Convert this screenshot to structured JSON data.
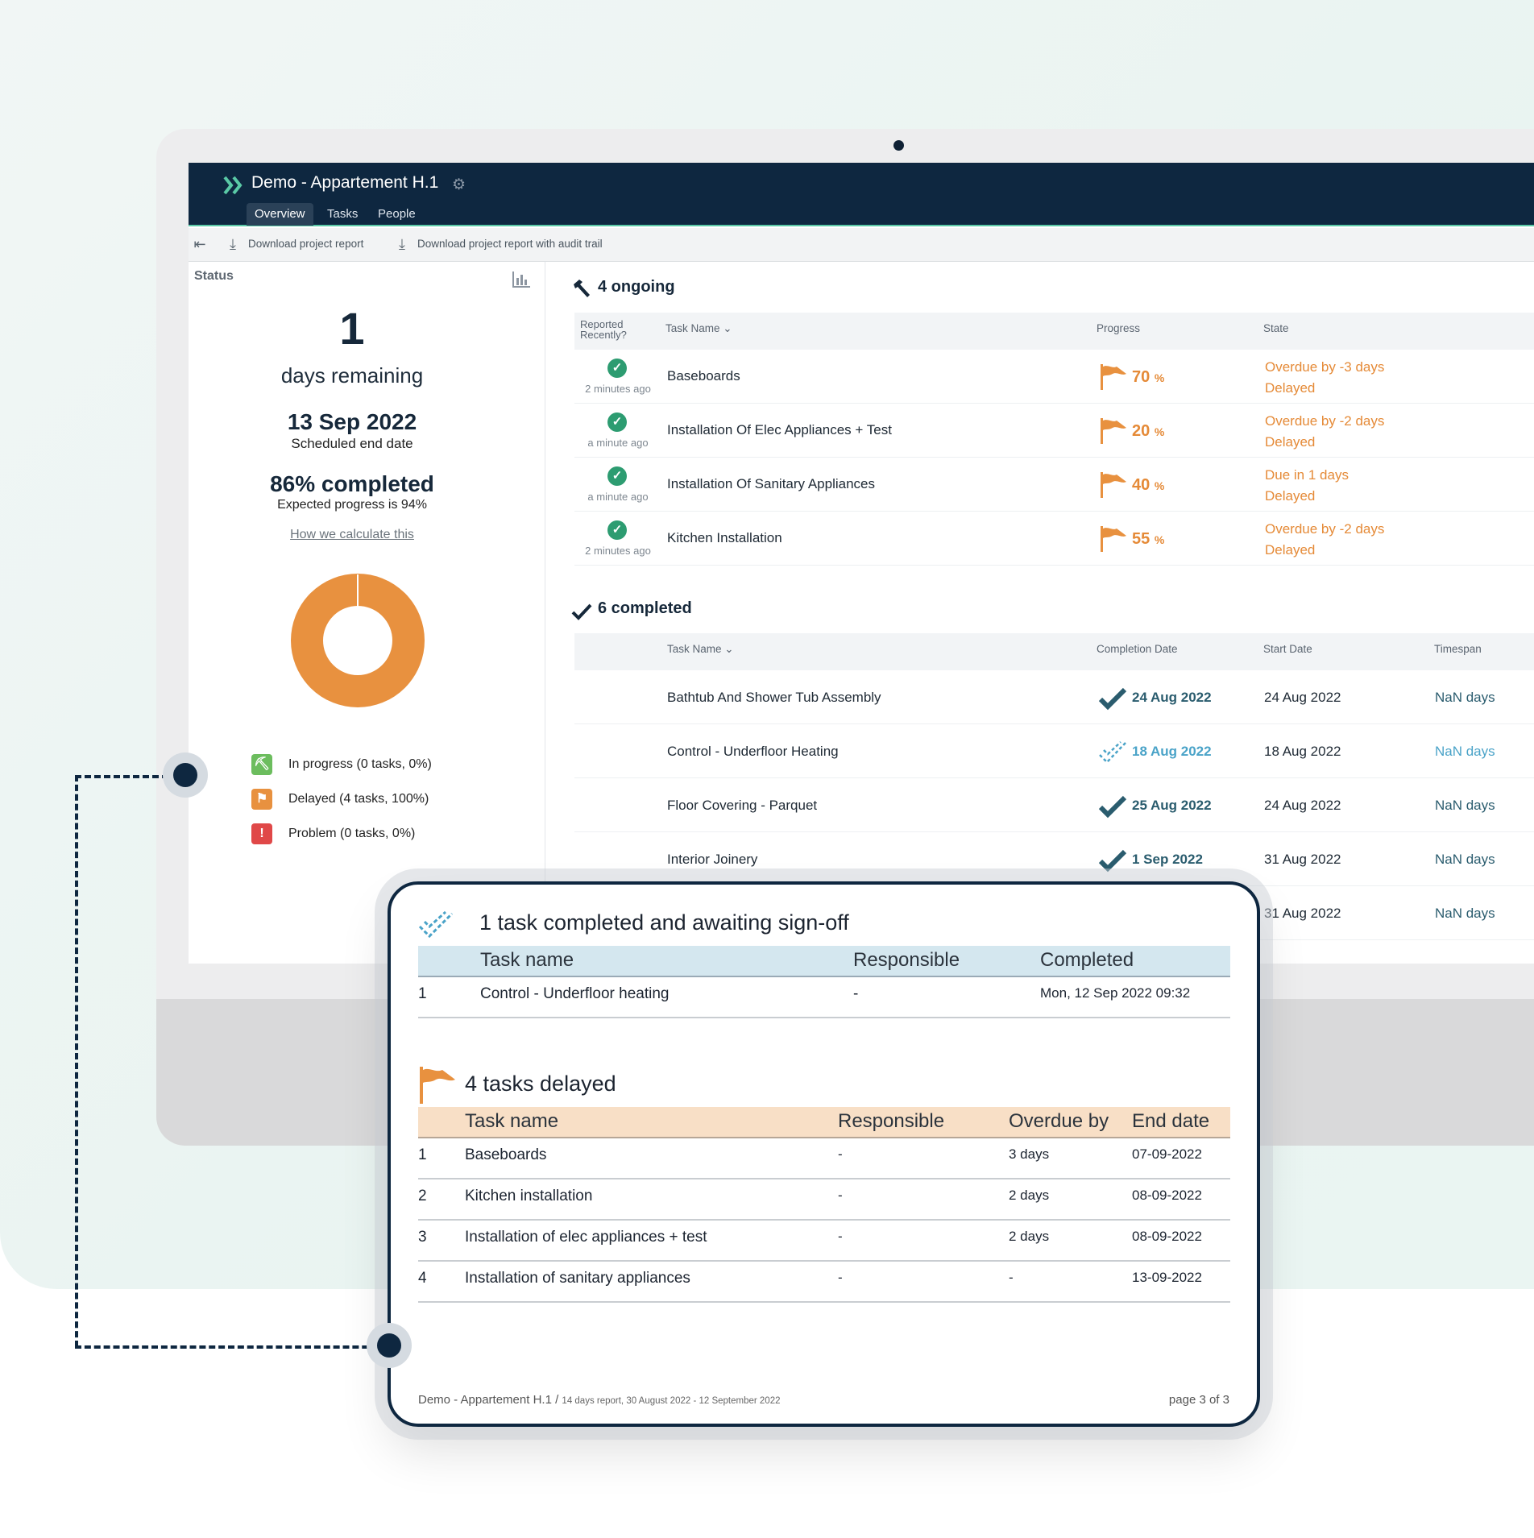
{
  "app": {
    "project_title": "Demo - Appartement H.1",
    "tabs": [
      "Overview",
      "Tasks",
      "People"
    ],
    "active_tab": "Overview"
  },
  "toolbar": {
    "download_report": "Download project report",
    "download_audit": "Download project report with audit trail"
  },
  "status": {
    "label": "Status",
    "days_remaining_value": "1",
    "days_remaining_label": "days remaining",
    "end_date": "13 Sep 2022",
    "end_date_label": "Scheduled end date",
    "completed": "86% completed",
    "expected": "Expected progress is 94%",
    "how_link": "How we calculate this",
    "donut_delayed_fraction": 1.0,
    "legend": [
      {
        "label": "In progress (0 tasks, 0%)",
        "color": "#6cbd5e",
        "icon": "worker-icon"
      },
      {
        "label": "Delayed (4 tasks, 100%)",
        "color": "#e8913f",
        "icon": "flag-icon"
      },
      {
        "label": "Problem (0 tasks, 0%)",
        "color": "#e04848",
        "icon": "exclamation-icon"
      }
    ]
  },
  "ongoing": {
    "heading": "4 ongoing",
    "columns": {
      "reported": "Reported Recently?",
      "task": "Task Name",
      "progress": "Progress",
      "state": "State"
    },
    "rows": [
      {
        "ago": "2 minutes ago",
        "task": "Baseboards",
        "progress": "70",
        "state1": "Overdue by -3 days",
        "state2": "Delayed"
      },
      {
        "ago": "a minute ago",
        "task": "Installation Of Elec Appliances + Test",
        "progress": "20",
        "state1": "Overdue by -2 days",
        "state2": "Delayed"
      },
      {
        "ago": "a minute ago",
        "task": "Installation Of Sanitary Appliances",
        "progress": "40",
        "state1": "Due in 1 days",
        "state2": "Delayed"
      },
      {
        "ago": "2 minutes ago",
        "task": "Kitchen Installation",
        "progress": "55",
        "state1": "Overdue by -2 days",
        "state2": "Delayed"
      }
    ]
  },
  "completed": {
    "heading": "6 completed",
    "columns": {
      "task": "Task Name",
      "completion": "Completion Date",
      "start": "Start Date",
      "timespan": "Timespan"
    },
    "rows": [
      {
        "task": "Bathtub And Shower Tub Assembly",
        "completion": "24 Aug 2022",
        "start": "24 Aug 2022",
        "timespan": "NaN days",
        "awaiting": false
      },
      {
        "task": "Control - Underfloor Heating",
        "completion": "18 Aug 2022",
        "start": "18 Aug 2022",
        "timespan": "NaN days",
        "awaiting": true
      },
      {
        "task": "Floor Covering - Parquet",
        "completion": "25 Aug 2022",
        "start": "24 Aug 2022",
        "timespan": "NaN days",
        "awaiting": false
      },
      {
        "task": "Interior Joinery",
        "completion": "1 Sep 2022",
        "start": "31 Aug 2022",
        "timespan": "NaN days",
        "awaiting": false
      },
      {
        "task": "",
        "completion": "",
        "start": "31 Aug 2022",
        "timespan": "NaN days",
        "awaiting": false
      }
    ]
  },
  "report": {
    "signoff_title": "1 task completed and awaiting sign-off",
    "signoff_columns": [
      "Task name",
      "Responsible",
      "Completed"
    ],
    "signoff_rows": [
      {
        "n": "1",
        "task": "Control - Underfloor heating",
        "resp": "-",
        "completed": "Mon, 12 Sep 2022 09:32"
      }
    ],
    "delayed_title": "4 tasks delayed",
    "delayed_columns": [
      "Task name",
      "Responsible",
      "Overdue by",
      "End date"
    ],
    "delayed_rows": [
      {
        "n": "1",
        "task": "Baseboards",
        "resp": "-",
        "overdue": "3 days",
        "end": "07-09-2022"
      },
      {
        "n": "2",
        "task": "Kitchen installation",
        "resp": "-",
        "overdue": "2 days",
        "end": "08-09-2022"
      },
      {
        "n": "3",
        "task": "Installation of elec appliances + test",
        "resp": "-",
        "overdue": "2 days",
        "end": "08-09-2022"
      },
      {
        "n": "4",
        "task": "Installation of sanitary appliances",
        "resp": "-",
        "overdue": "-",
        "end": "13-09-2022"
      }
    ],
    "footer_project": "Demo - Appartement H.1 /",
    "footer_range": "14 days report, 30 August 2022 - 12 September 2022",
    "footer_page": "page 3 of 3"
  },
  "colors": {
    "navy": "#0e2740",
    "accent": "#5ac9a6",
    "orange": "#e58a37",
    "teal_done": "#2a5c6e",
    "awaiting": "#4aa3c8"
  }
}
